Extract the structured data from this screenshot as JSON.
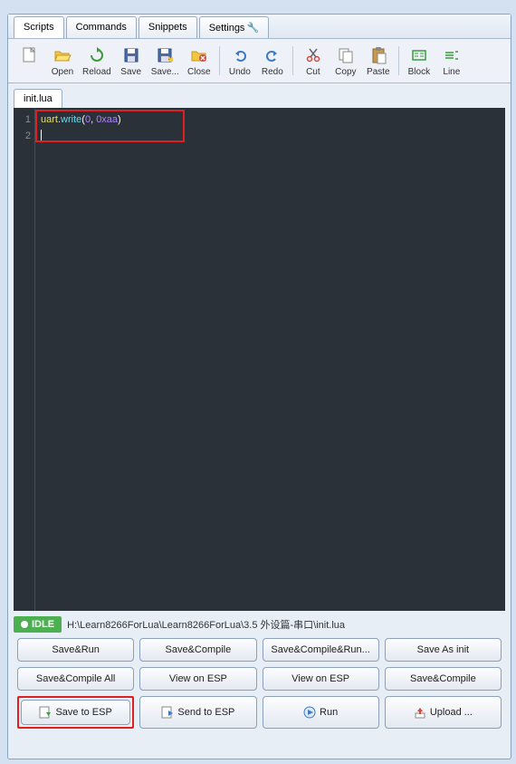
{
  "tabs": {
    "scripts": "Scripts",
    "commands": "Commands",
    "snippets": "Snippets",
    "settings": "Settings"
  },
  "toolbar": {
    "open": "Open",
    "reload": "Reload",
    "save": "Save",
    "saveas": "Save...",
    "close": "Close",
    "undo": "Undo",
    "redo": "Redo",
    "cut": "Cut",
    "copy": "Copy",
    "paste": "Paste",
    "block": "Block",
    "line": "Line"
  },
  "file_tab": "init.lua",
  "code": {
    "lines": [
      "uart.write(0, 0xaa)",
      ""
    ]
  },
  "status": {
    "idle": "IDLE",
    "path": "H:\\Learn8266ForLua\\Learn8266ForLua\\3.5 外设篇-串口\\init.lua"
  },
  "buttons": {
    "save_run": "Save&Run",
    "save_compile": "Save&Compile",
    "save_compile_run": "Save&Compile&Run...",
    "save_as_init": "Save As init",
    "save_compile_all": "Save&Compile All",
    "view_on_esp1": "View on ESP",
    "view_on_esp2": "View on ESP",
    "save_compile2": "Save&Compile",
    "save_to_esp": "Save to ESP",
    "send_to_esp": "Send to ESP",
    "run": "Run",
    "upload": "Upload ..."
  }
}
